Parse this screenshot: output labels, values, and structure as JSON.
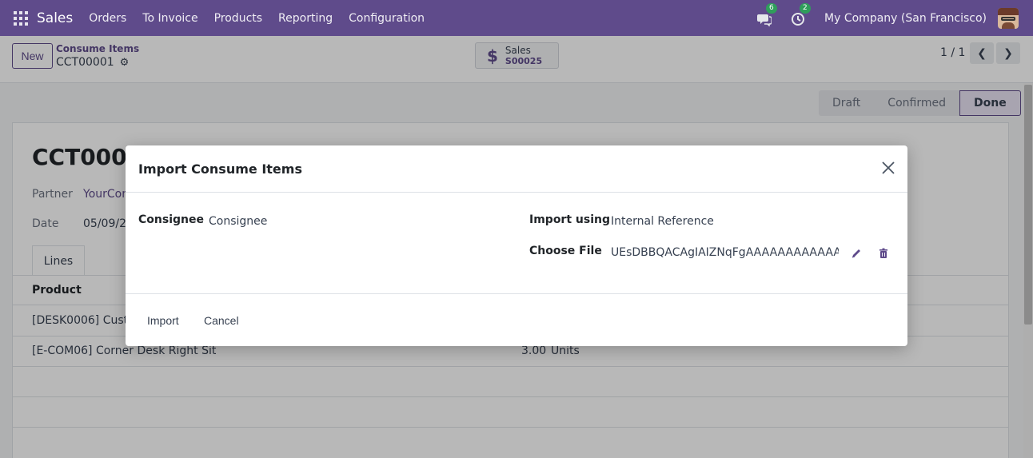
{
  "navbar": {
    "brand": "Sales",
    "menu": [
      "Orders",
      "To Invoice",
      "Products",
      "Reporting",
      "Configuration"
    ],
    "messages_count": "6",
    "activities_count": "2",
    "company": "My Company (San Francisco)"
  },
  "control": {
    "new_label": "New",
    "breadcrumb_parent": "Consume Items",
    "breadcrumb_current": "CCT00001",
    "smart_label": "Sales",
    "smart_value": "S00025",
    "pager": "1 / 1"
  },
  "status": [
    "Draft",
    "Confirmed",
    "Done"
  ],
  "form": {
    "title": "CCT0000",
    "partner_label": "Partner",
    "partner_value": "YourCom",
    "date_label": "Date",
    "date_value": "05/09/20",
    "tab_lines": "Lines",
    "col_product": "Product",
    "rows": [
      {
        "product": "[DESK0006] Custor",
        "qty": "",
        "uom": ""
      },
      {
        "product": "[E-COM06] Corner Desk Right Sit",
        "qty": "3.00",
        "uom": "Units"
      }
    ]
  },
  "modal": {
    "title": "Import Consume Items",
    "consignee_label": "Consignee",
    "consignee_value": "Consignee",
    "import_using_label": "Import using",
    "import_using_value": "Internal Reference",
    "choose_file_label": "Choose File",
    "choose_file_value": "UEsDBBQACAgIAIZNqFgAAAAAAAAAAAAA",
    "import_label": "Import",
    "cancel_label": "Cancel"
  },
  "colors": {
    "brand": "#5f4b8b",
    "badge": "#2f9e5b"
  }
}
